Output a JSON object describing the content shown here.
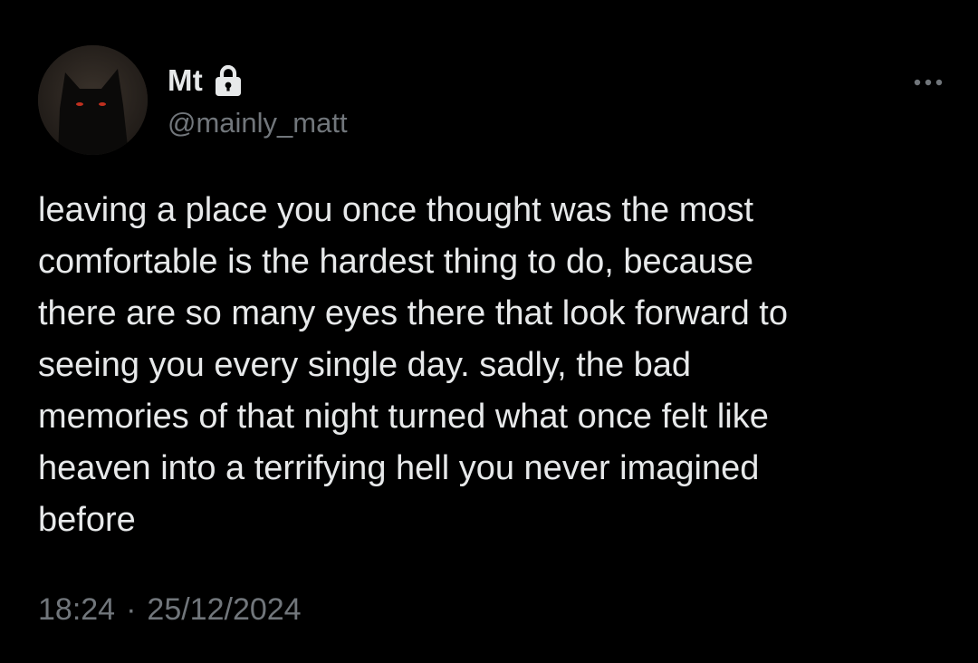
{
  "author": {
    "display_name": "Mt",
    "handle": "@mainly_matt",
    "protected": true,
    "avatar": "black-cat-red-eyes"
  },
  "tweet": {
    "text": "leaving a place you once thought was the most\ncomfortable is the hardest thing to do, because\nthere are so many eyes there that look forward to\nseeing you every single day. sadly, the bad\nmemories of that night turned what once felt like\nheaven into a terrifying hell you never imagined\nbefore",
    "time": "18:24",
    "separator": "·",
    "date": "25/12/2024"
  },
  "icons": {
    "lock": "lock-icon",
    "more": "more-icon"
  },
  "colors": {
    "background": "#000000",
    "primary_text": "#e7e9ea",
    "secondary_text": "#71767b"
  }
}
